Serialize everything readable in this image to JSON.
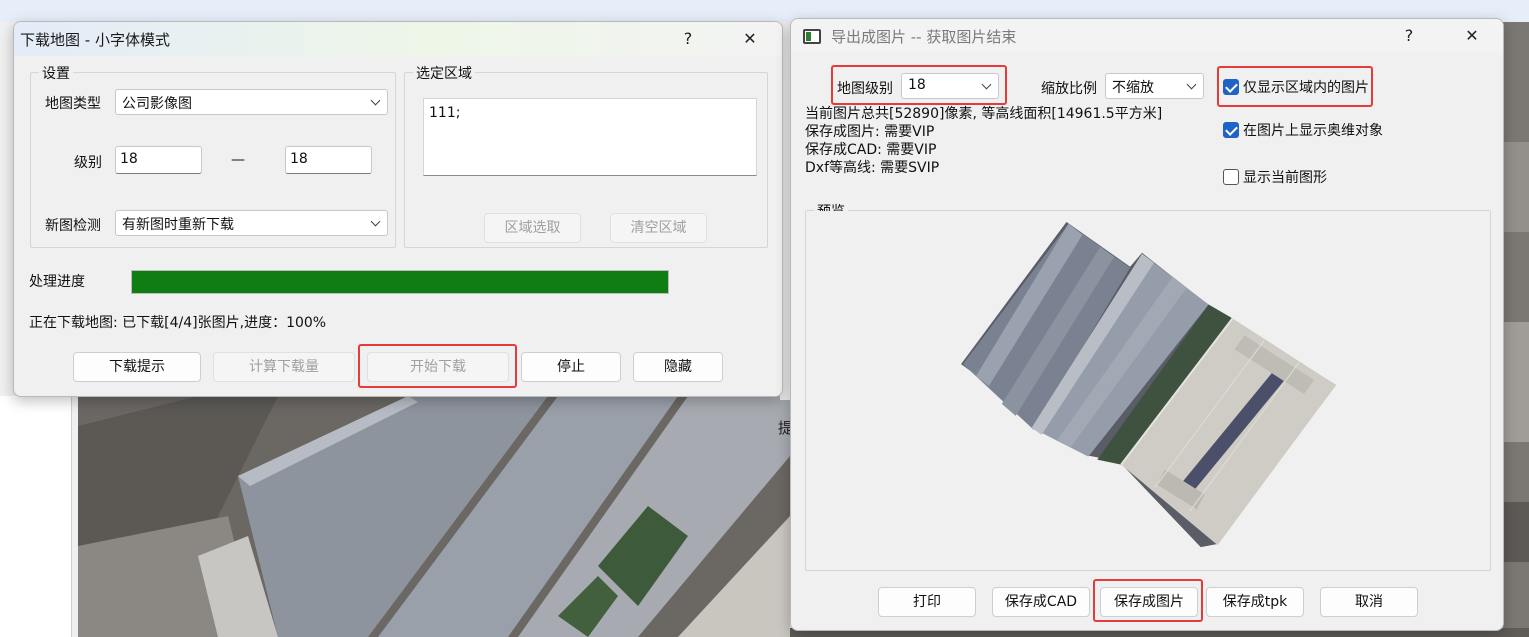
{
  "download_dialog": {
    "title": "下载地图 - 小字体模式",
    "help_label": "?",
    "close_label": "✕",
    "settings": {
      "group_title": "设置",
      "map_type_label": "地图类型",
      "map_type_value": "公司影像图",
      "level_label": "级别",
      "level_from": "18",
      "level_sep": "—",
      "level_to": "18",
      "new_check_label": "新图检测",
      "new_check_value": "有新图时重新下载"
    },
    "area": {
      "group_title": "选定区域",
      "content": "111;",
      "select_button": "区域选取",
      "clear_button": "清空区域"
    },
    "progress_label": "处理进度",
    "progress_fraction": 1.0,
    "progress_color": "#0f7d14",
    "status_text": "正在下载地图: 已下载[4/4]张图片,进度：100%",
    "buttons": {
      "hint": "下载提示",
      "calc": "计算下载量",
      "start": "开始下载",
      "stop": "停止",
      "hide": "隐藏"
    }
  },
  "export_dialog": {
    "title": "导出成图片 -- 获取图片结束",
    "help_label": "?",
    "close_label": "✕",
    "level_label": "地图级别",
    "level_value": "18",
    "scale_label": "缩放比例",
    "scale_value": "不缩放",
    "info_lines": [
      "当前图片总共[52890]像素, 等高线面积[14961.5平方米]",
      "保存成图片: 需要VIP",
      "保存成CAD: 需要VIP",
      "Dxf等高线: 需要SVIP"
    ],
    "options": [
      {
        "label": "仅显示区域内的图片",
        "checked": true
      },
      {
        "label": "在图片上显示奥维对象",
        "checked": true
      },
      {
        "label": "显示当前图形",
        "checked": false
      }
    ],
    "preview_title": "预览",
    "buttons": {
      "print": "打印",
      "save_cad": "保存成CAD",
      "save_image": "保存成图片",
      "save_tpk": "保存成tpk",
      "cancel": "取消"
    }
  },
  "background": {
    "side_char": "提"
  },
  "colors": {
    "highlight_red": "#e53b3b",
    "checkbox_blue": "#1f63c8"
  }
}
